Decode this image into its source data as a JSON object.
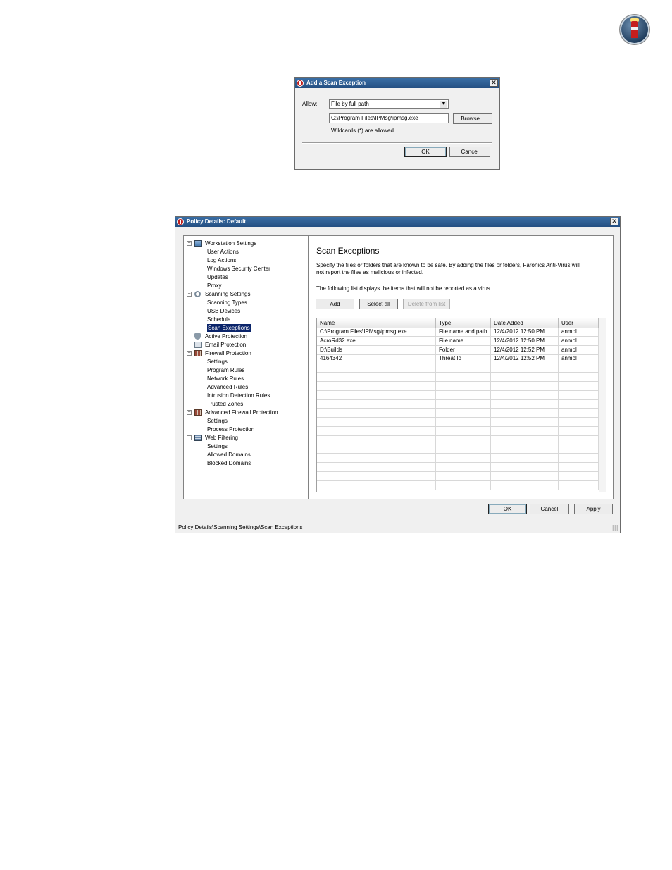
{
  "add_dialog": {
    "title": "Add a Scan Exception",
    "allow_label": "Allow:",
    "allow_value": "File by full path",
    "path_value": "C:\\Program Files\\IPMsg\\ipmsg.exe",
    "browse_label": "Browse...",
    "hint": "Wildcards (*) are allowed",
    "ok_label": "OK",
    "cancel_label": "Cancel"
  },
  "policy_dialog": {
    "title": "Policy Details: Default",
    "tree": [
      {
        "label": "Workstation Settings",
        "level": 0,
        "expander": "⊟",
        "icon": "ws"
      },
      {
        "label": "User Actions",
        "level": 1
      },
      {
        "label": "Log Actions",
        "level": 1
      },
      {
        "label": "Windows Security Center",
        "level": 1
      },
      {
        "label": "Updates",
        "level": 1
      },
      {
        "label": "Proxy",
        "level": 1
      },
      {
        "label": "Scanning Settings",
        "level": 0,
        "expander": "⊟",
        "icon": "scan"
      },
      {
        "label": "Scanning Types",
        "level": 1
      },
      {
        "label": "USB Devices",
        "level": 1
      },
      {
        "label": "Schedule",
        "level": 1
      },
      {
        "label": "Scan Exceptions",
        "level": 1,
        "selected": true
      },
      {
        "label": "Active Protection",
        "level": 0,
        "icon": "shield"
      },
      {
        "label": "Email Protection",
        "level": 0,
        "icon": "mail"
      },
      {
        "label": "Firewall Protection",
        "level": 0,
        "expander": "⊟",
        "icon": "fw"
      },
      {
        "label": "Settings",
        "level": 1
      },
      {
        "label": "Program Rules",
        "level": 1
      },
      {
        "label": "Network Rules",
        "level": 1
      },
      {
        "label": "Advanced Rules",
        "level": 1
      },
      {
        "label": "Intrusion Detection Rules",
        "level": 1
      },
      {
        "label": "Trusted Zones",
        "level": 1
      },
      {
        "label": "Advanced Firewall Protection",
        "level": 0,
        "expander": "⊟",
        "icon": "fw"
      },
      {
        "label": "Settings",
        "level": 1
      },
      {
        "label": "Process Protection",
        "level": 1
      },
      {
        "label": "Web Filtering",
        "level": 0,
        "expander": "⊟",
        "icon": "web"
      },
      {
        "label": "Settings",
        "level": 1
      },
      {
        "label": "Allowed Domains",
        "level": 1
      },
      {
        "label": "Blocked Domains",
        "level": 1
      }
    ],
    "heading": "Scan Exceptions",
    "description": "Specify the files or folders that are known to be safe. By adding the files or folders, Faronics Anti-Virus will not report the files as malicious or infected.",
    "list_intro": "The following list displays the items that will not be reported as a virus.",
    "add_label": "Add",
    "select_all_label": "Select all",
    "delete_label": "Delete from list",
    "columns": [
      "Name",
      "Type",
      "Date Added",
      "User"
    ],
    "rows": [
      [
        "C:\\Program Files\\IPMsg\\ipmsg.exe",
        "File name and path",
        "12/4/2012 12:50 PM",
        "anmol"
      ],
      [
        "AcroRd32.exe",
        "File name",
        "12/4/2012 12:50 PM",
        "anmol"
      ],
      [
        "D:\\Builds",
        "Folder",
        "12/4/2012 12:52 PM",
        "anmol"
      ],
      [
        "4164342",
        "Threat Id",
        "12/4/2012 12:52 PM",
        "anmol"
      ]
    ],
    "ok_label": "OK",
    "cancel_label": "Cancel",
    "apply_label": "Apply",
    "status": "Policy Details\\Scanning Settings\\Scan Exceptions"
  }
}
